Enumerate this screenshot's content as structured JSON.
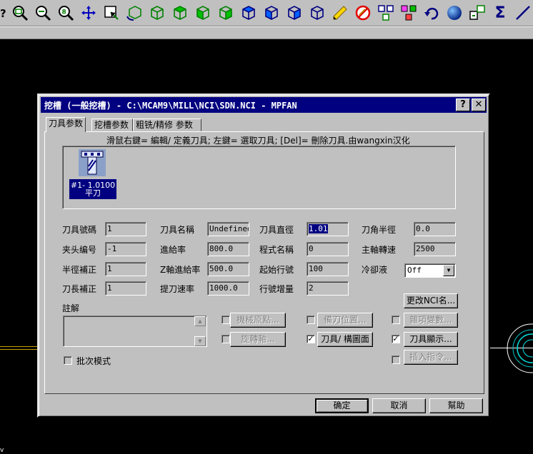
{
  "toolbar": {
    "help_glyph": "?",
    "sigma_glyph": "Σ"
  },
  "dialog": {
    "title": "挖槽 (一般挖槽) - C:\\MCAM9\\MILL\\NCI\\SDN.NCI - MPFAN",
    "help_glyph": "?",
    "close_glyph": "✕",
    "tabs": [
      {
        "label": "刀具参数"
      },
      {
        "label": "挖槽参数"
      },
      {
        "label": "粗铣/精修 参数"
      }
    ],
    "hint": "滑鼠右鍵= 編輯/ 定義刀具; 左鍵= 選取刀具; [Del]= 刪除刀具.由wangxin汉化",
    "tool": {
      "line1": "#1- 1.0100",
      "line2": "平刀"
    },
    "fields": {
      "tool_number": {
        "label": "刀具號碼",
        "value": "1"
      },
      "tool_name": {
        "label": "刀具名稱",
        "value": "Undefined"
      },
      "tool_diameter": {
        "label": "刀具直徑",
        "value": "1.01"
      },
      "corner_radius": {
        "label": "刀角半徑",
        "value": "0.0"
      },
      "holder_number": {
        "label": "夹头编号",
        "value": "-1"
      },
      "feed_rate": {
        "label": "進給率",
        "value": "800.0"
      },
      "program_name": {
        "label": "程式名稱",
        "value": "0"
      },
      "spindle_speed": {
        "label": "主軸轉速",
        "value": "2500"
      },
      "radius_comp": {
        "label": "半徑補正",
        "value": "1"
      },
      "z_feed_rate": {
        "label": "Z軸進給率",
        "value": "500.0"
      },
      "start_line": {
        "label": "起始行號",
        "value": "100"
      },
      "coolant": {
        "label": "冷卻液",
        "value": "Off"
      },
      "length_comp": {
        "label": "刀長補正",
        "value": "1"
      },
      "retract_rate": {
        "label": "提刀速率",
        "value": "1000.0"
      },
      "line_increment": {
        "label": "行號增量",
        "value": "2"
      }
    },
    "change_nci_label": "更改NCI名...",
    "notes_label": "註解",
    "batch_mode_label": "批次模式",
    "options": {
      "machine_origin": "機械原點...",
      "rotary_axis": "旋轉軸...",
      "tool_change_pos": "備刀位置...",
      "tool_plane": "刀具/ 構圖面",
      "misc_values": "雜項變數...",
      "tool_display": "刀具顯示...",
      "insert_directive": "插入指令..."
    },
    "buttons": {
      "ok": "确定",
      "cancel": "取消",
      "help": "幫助"
    }
  }
}
